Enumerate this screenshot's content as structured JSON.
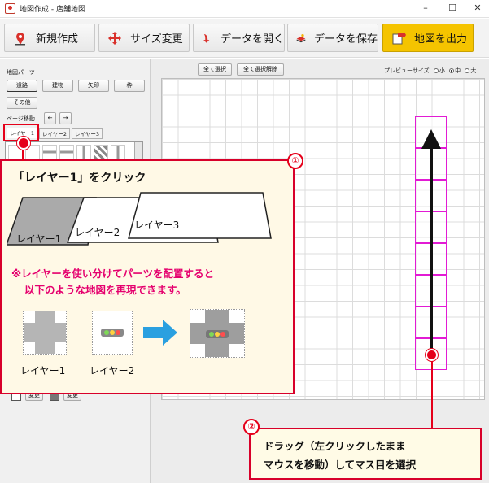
{
  "window": {
    "title": "地図作成 - 店舗地図",
    "minimize": "–",
    "maximize": "☐",
    "close": "✕"
  },
  "toolbar": {
    "new": "新規作成",
    "resize": "サイズ変更",
    "open": "データを開く",
    "save": "データを保存",
    "output": "地図を出力"
  },
  "left_panel": {
    "section_label": "地図パーツ",
    "parts_buttons": [
      "道路",
      "建物",
      "矢印",
      "枠"
    ],
    "other_button": "その他",
    "page_move_label": "ページ移動",
    "page_prev": "←",
    "page_next": "→",
    "layer_tabs": [
      "レイヤー1",
      "レイヤー2",
      "レイヤー3"
    ],
    "change_label": "変更"
  },
  "right_panel": {
    "select_all": "全て選択",
    "deselect_all": "全て選択解除",
    "preview_size_label": "プレビューサイズ",
    "sizes": [
      "小",
      "中",
      "大"
    ],
    "selected_size": "中"
  },
  "callout1": {
    "number": "①",
    "title": "「レイヤー1」をクリック",
    "sheets": [
      "レイヤー1",
      "レイヤー2",
      "レイヤー3"
    ],
    "note_line1": "※レイヤーを使い分けてパーツを配置すると",
    "note_line2": "以下のような地図を再現できます。",
    "example_labels": [
      "レイヤー1",
      "レイヤー2"
    ]
  },
  "callout2": {
    "number": "②",
    "line1": "ドラッグ（左クリックしたまま",
    "line2": "マウスを移動）してマス目を選択"
  },
  "colors": {
    "accent_red": "#e5001a",
    "note_pink": "#e5006e",
    "selection_magenta": "#e21bd4",
    "output_yellow": "#f5c400",
    "arrow_blue": "#2aa0e0"
  }
}
